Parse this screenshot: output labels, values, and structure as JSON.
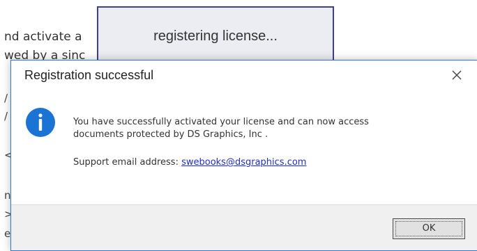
{
  "background_document": {
    "line1": "nd activate a",
    "line2": "wed by a sinc",
    "fragments": [
      "/",
      "/",
      "<",
      "n",
      ">",
      "e"
    ]
  },
  "progress_popup": {
    "text": "registering license..."
  },
  "dialog": {
    "title": "Registration successful",
    "close_icon": "close-icon",
    "info_icon": "info-icon",
    "message_line1": "You have successfully activated your license and can now access",
    "message_line2": "documents protected by DS Graphics, Inc .",
    "support_label": "Support email address: ",
    "support_email": "swebooks@dsgraphics.com",
    "ok_label": "OK"
  },
  "colors": {
    "accent_border": "#2a78d2",
    "info_icon_blue": "#1b74d3",
    "link_blue": "#1e2fd0",
    "popup_border": "#3d3d9a",
    "footer_bg": "#f0f0f0"
  }
}
